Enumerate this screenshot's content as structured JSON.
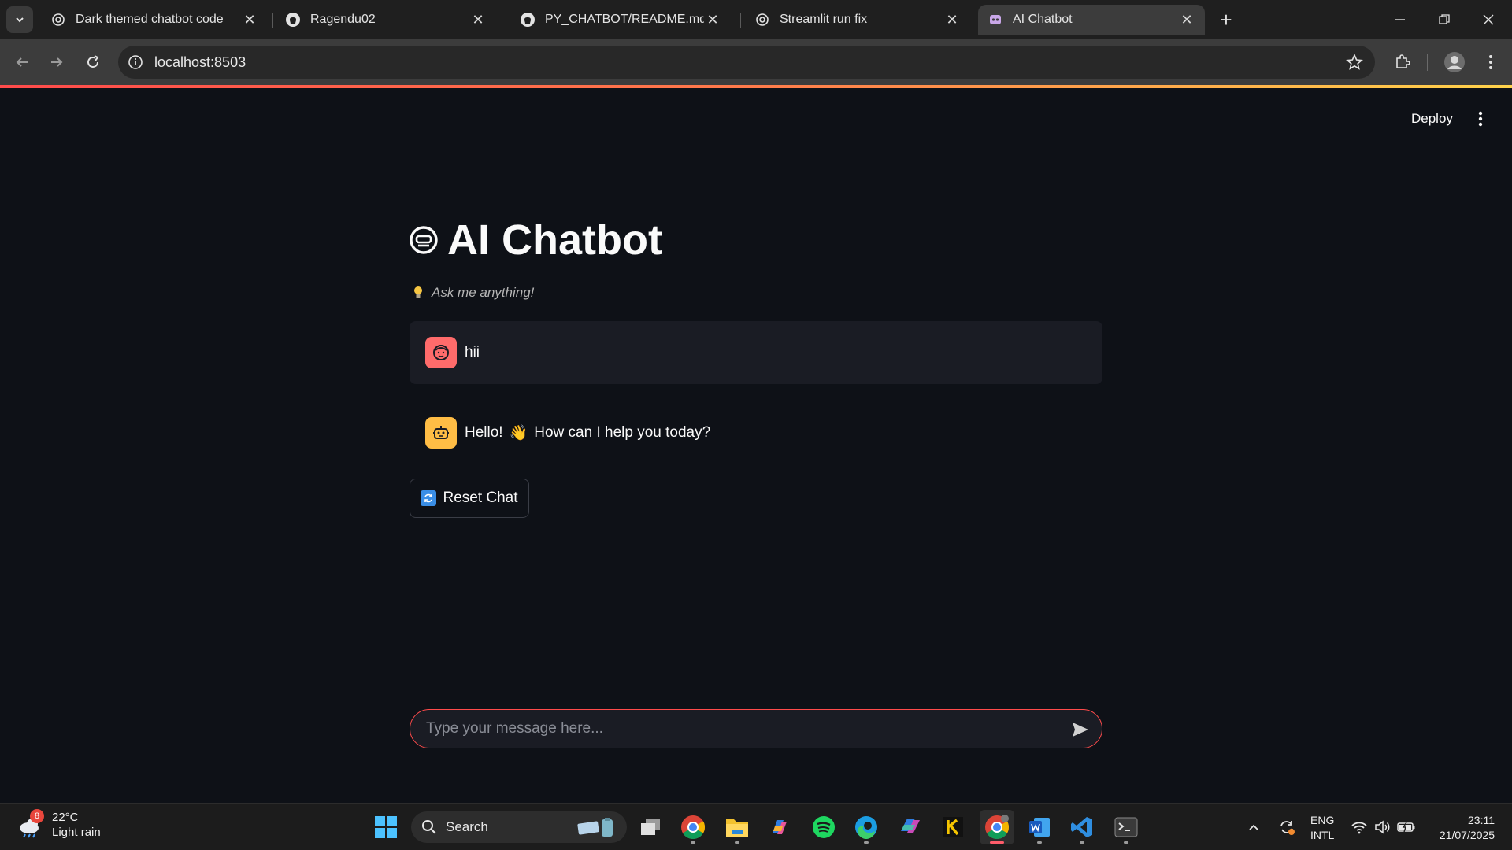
{
  "browser": {
    "tabs": [
      {
        "title": "Dark themed chatbot code",
        "favicon": "openai-icon"
      },
      {
        "title": "Ragendu02",
        "favicon": "github-icon"
      },
      {
        "title": "PY_CHATBOT/README.md at m",
        "favicon": "github-icon"
      },
      {
        "title": "Streamlit run fix",
        "favicon": "openai-icon"
      },
      {
        "title": "AI Chatbot",
        "favicon": "streamlit-icon",
        "active": true
      }
    ],
    "url": "localhost:8503",
    "accent_gradient": [
      "#ff4b4b",
      "#ffd34b"
    ]
  },
  "app": {
    "deploy_label": "Deploy",
    "title": "AI Chatbot",
    "subtitle": "Ask me anything!",
    "messages": [
      {
        "role": "user",
        "avatar": "user-face-icon",
        "text": "hii"
      },
      {
        "role": "assistant",
        "avatar": "robot-icon",
        "text_before": "Hello!",
        "emoji": "👋",
        "text_after": "How can I help you today?"
      }
    ],
    "reset_label": "Reset Chat",
    "input_placeholder": "Type your message here...",
    "colors": {
      "background": "#0e1117",
      "user_bubble": "#1a1c24",
      "user_avatar": "#ff6b6b",
      "bot_avatar": "#ffbd45",
      "input_border": "#ff4b4b"
    }
  },
  "taskbar": {
    "weather_temp": "22°C",
    "weather_desc": "Light rain",
    "weather_badge": "8",
    "search_label": "Search",
    "language_line1": "ENG",
    "language_line2": "INTL",
    "time": "23:11",
    "date": "21/07/2025"
  }
}
